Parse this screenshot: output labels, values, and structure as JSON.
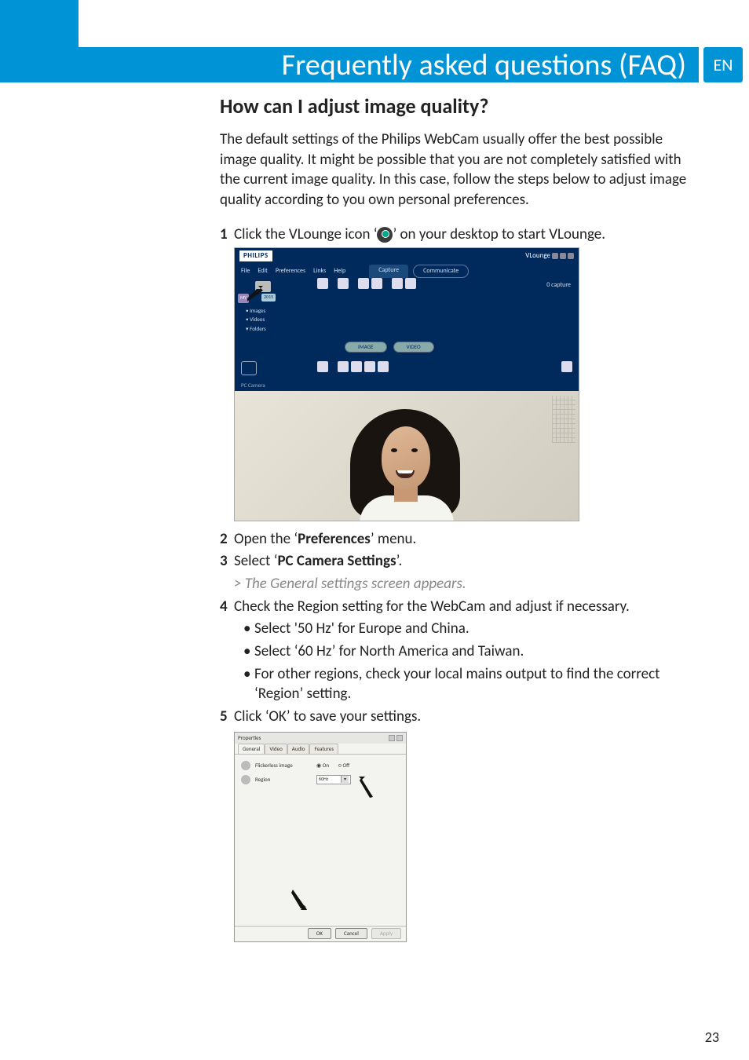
{
  "lang": "EN",
  "header": "Frequently asked questions (FAQ)",
  "h2": "How can I adjust image quality?",
  "intro": "The default settings of the Philips WebCam usually offer the best possible image quality. It might be possible that you are not completely satisfied with the current image quality. In this case, follow the steps below to adjust image quality according to you own personal preferences.",
  "steps": {
    "s1a": "Click the VLounge icon ‘",
    "s1b": "’ on your desktop to start VLounge.",
    "s2a": "Open the ‘",
    "s2b": "Preferences",
    "s2c": "’ menu.",
    "s3a": "Select ‘",
    "s3b": "PC Camera Settings",
    "s3c": "’.",
    "note3": "> The General settings screen appears.",
    "s4": "Check the Region setting for the WebCam and adjust if necessary.",
    "b4_1": "Select '50 Hz' for Europe and China.",
    "b4_2": "Select ‘60 Hz’ for North America and Taiwan.",
    "b4_3": "For other regions, check your local mains output to find the correct ‘Region’ setting.",
    "s5": "Click ‘OK’ to save your settings."
  },
  "nums": {
    "n1": "1",
    "n2": "2",
    "n3": "3",
    "n4": "4",
    "n5": "5"
  },
  "fig1": {
    "logo": "PHILIPS",
    "vlounge": "VLounge",
    "menu": {
      "file": "File",
      "edit": "Edit",
      "prefs": "Preferences",
      "links": "Links",
      "help": "Help"
    },
    "tabs": {
      "capture": "Capture",
      "communicate": "Communicate"
    },
    "sideMy": "MY",
    "sideDate": "2015",
    "sidebar": {
      "images": "• Images",
      "videos": "• Videos",
      "folders": "▾ Folders"
    },
    "captureCount": "0 capture",
    "lozenge": {
      "image": "IMAGE",
      "video": "VIDEO"
    },
    "pcCamera": "PC Camera"
  },
  "fig2": {
    "title": "Properties",
    "tabs": {
      "general": "General",
      "video": "Video",
      "audio": "Audio",
      "features": "Features"
    },
    "rows": {
      "flicker": "Flickerless image",
      "region": "Region",
      "on": "On",
      "off": "Off",
      "select": "60Hz"
    },
    "buttons": {
      "ok": "OK",
      "cancel": "Cancel",
      "apply": "Apply"
    }
  },
  "pageNum": "23"
}
